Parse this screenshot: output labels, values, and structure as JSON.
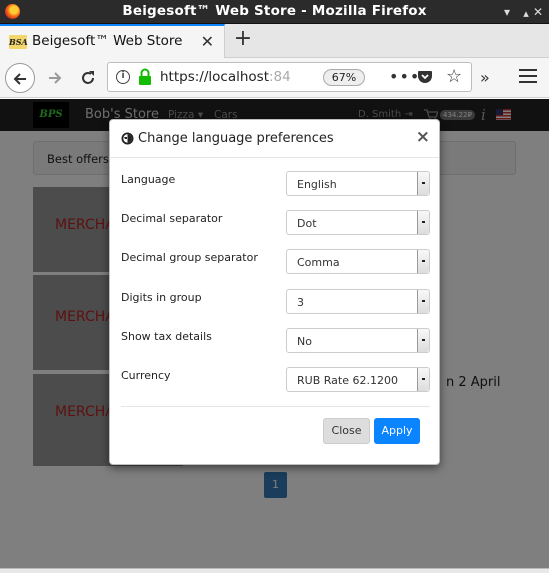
{
  "window": {
    "title": "Beigesoft™ Web Store - Mozilla Firefox"
  },
  "tab": {
    "favicon_text": "BSA",
    "title": "Beigesoft™ Web Store",
    "close": "✕",
    "new_tab": "+"
  },
  "urlbar": {
    "url_main": "https://localhost",
    "url_faded": ":84",
    "zoom": "67%",
    "more": "•••"
  },
  "site": {
    "logo": "BPS",
    "brand": "Bob's Store",
    "nav_pizza": "Pizza ▾",
    "nav_cars": "Cars",
    "user": "D. Smith ⇥",
    "cart_badge": "434.22₽",
    "breadcrumb": "Best offers",
    "merch1": "MERCHA",
    "merch2": "MERCHA",
    "merch3": "MERCHA",
    "side_text": "n 2 April",
    "page_number": "1"
  },
  "modal": {
    "title": "Change language preferences",
    "close": "×",
    "rows": [
      {
        "label": "Language",
        "value": "English"
      },
      {
        "label": "Decimal separator",
        "value": "Dot"
      },
      {
        "label": "Decimal group separator",
        "value": "Comma"
      },
      {
        "label": "Digits in group",
        "value": "3"
      },
      {
        "label": "Show tax details",
        "value": "No"
      },
      {
        "label": "Currency",
        "value": "RUB Rate 62.1200"
      }
    ],
    "close_button": "Close",
    "apply_button": "Apply"
  },
  "colors": {
    "accent": "#0a84ff",
    "pager": "#337ab7",
    "merch_text": "#b22222"
  }
}
